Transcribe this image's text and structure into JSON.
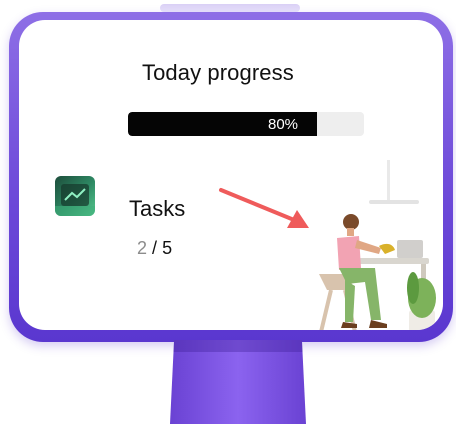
{
  "progress": {
    "title": "Today progress",
    "percent": 80,
    "percent_label": "80%"
  },
  "tasks": {
    "label": "Tasks",
    "done": "2",
    "separator": "/",
    "total": "5"
  },
  "colors": {
    "frame": "#6d4ad9",
    "bar_fill": "#050505",
    "bar_track": "#eeeeee",
    "arrow": "#ef5b5b",
    "plant": "#7db25a",
    "shirt": "#f2a3b3"
  },
  "icons": {
    "app": "app-icon",
    "arrow": "arrow-icon",
    "illustration": "desk-worker-illustration"
  }
}
